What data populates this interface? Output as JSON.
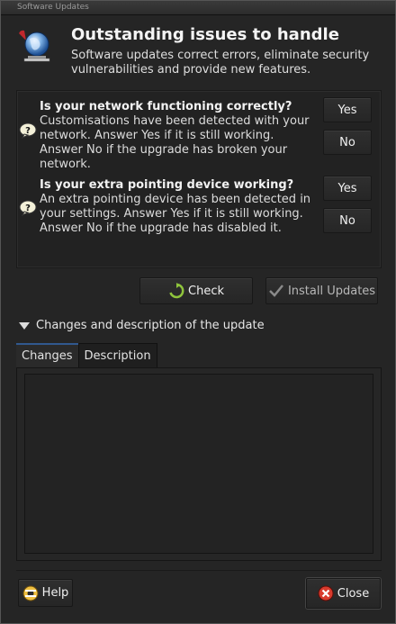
{
  "window": {
    "title": "Software Updates"
  },
  "header": {
    "icon": "globe-update-icon",
    "title": "Outstanding issues to handle",
    "description": "Software updates correct errors, eliminate security vulnerabilities and provide new features."
  },
  "issues": [
    {
      "icon": "question-bubble-icon",
      "title": "Is your network functioning correctly?",
      "text": "Customisations have been detected with your network. Answer Yes if it is still working. Answer No if the upgrade has broken your network.",
      "yes_label": "Yes",
      "no_label": "No"
    },
    {
      "icon": "question-bubble-icon",
      "title": "Is your extra pointing device working?",
      "text": "An extra pointing device has been detected in your settings. Answer Yes if it is still working. Answer No if the upgrade has disabled it.",
      "yes_label": "Yes",
      "no_label": "No"
    }
  ],
  "actions": {
    "check_label": "Check",
    "install_label": "Install Updates"
  },
  "expander": {
    "label": "Changes and description of the update"
  },
  "tabs": [
    {
      "label": "Changes"
    },
    {
      "label": "Description"
    }
  ],
  "footer": {
    "help_label": "Help",
    "close_label": "Close"
  }
}
